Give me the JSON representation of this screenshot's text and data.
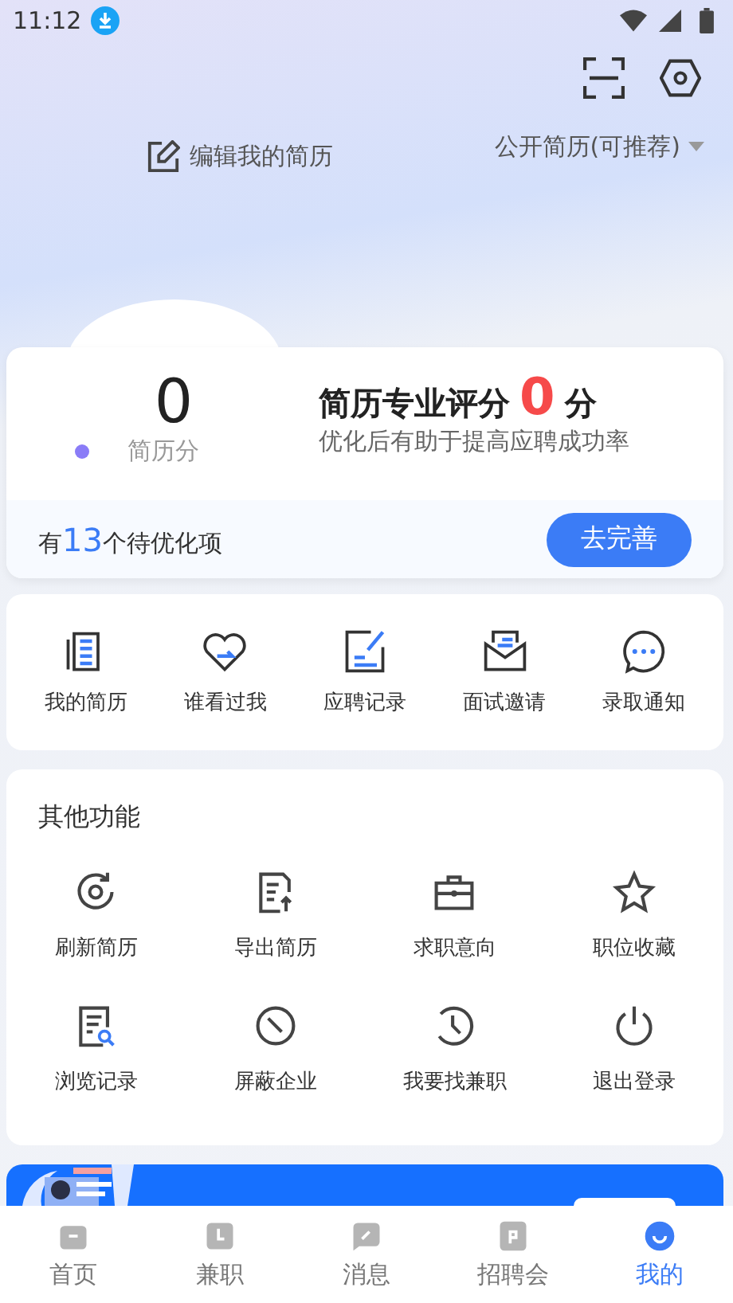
{
  "status_bar": {
    "time": "11:12"
  },
  "header": {
    "edit_label": "编辑我的简历",
    "visibility": "公开简历(可推荐)"
  },
  "score_card": {
    "score": "0",
    "score_label": "简历分",
    "title": "简历专业评分",
    "title_score": "0",
    "title_unit": "分",
    "subtitle": "优化后有助于提高应聘成功率",
    "pending_prefix": "有",
    "pending_count": "13",
    "pending_suffix": "个待优化项",
    "button": "去完善"
  },
  "quick_links": [
    {
      "label": "我的简历"
    },
    {
      "label": "谁看过我"
    },
    {
      "label": "应聘记录"
    },
    {
      "label": "面试邀请"
    },
    {
      "label": "录取通知"
    }
  ],
  "other_functions": {
    "title": "其他功能",
    "items": [
      {
        "label": "刷新简历"
      },
      {
        "label": "导出简历"
      },
      {
        "label": "求职意向"
      },
      {
        "label": "职位收藏"
      },
      {
        "label": "浏览记录"
      },
      {
        "label": "屏蔽企业"
      },
      {
        "label": "我要找兼职"
      },
      {
        "label": "退出登录"
      }
    ]
  },
  "tab_bar": [
    {
      "label": "首页",
      "selected": false
    },
    {
      "label": "兼职",
      "selected": false
    },
    {
      "label": "消息",
      "selected": false
    },
    {
      "label": "招聘会",
      "selected": false
    },
    {
      "label": "我的",
      "selected": true
    }
  ]
}
